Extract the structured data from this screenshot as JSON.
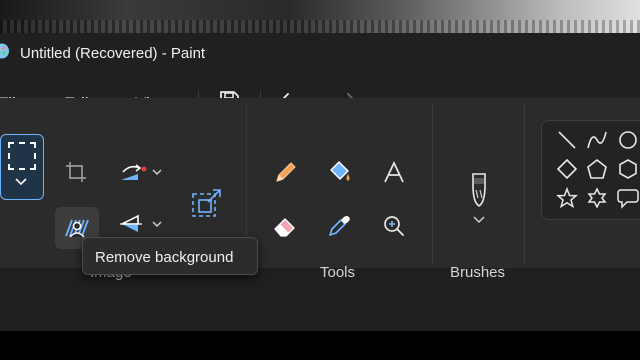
{
  "window": {
    "title": "Untitled (Recovered) - Paint"
  },
  "menu": {
    "file": "File",
    "edit": "Edit",
    "view": "View"
  },
  "toolbar": {
    "save_icon": "save-icon",
    "undo_icon": "undo-icon",
    "redo_icon": "redo-icon"
  },
  "ribbon": {
    "groups": {
      "image": "Image",
      "tools": "Tools",
      "brushes": "Brushes"
    },
    "image_tools": [
      "select-icon",
      "crop-icon",
      "rotate-icon",
      "remove-background-icon",
      "flip-icon",
      "resize-icon"
    ],
    "tools": [
      "pencil-icon",
      "fill-bucket-icon",
      "text-icon",
      "eraser-icon",
      "color-picker-icon",
      "magnifier-icon"
    ],
    "shapes": [
      "line-icon",
      "curve-icon",
      "oval-icon",
      "diamond-icon",
      "pentagon-icon",
      "hexagon-icon",
      "star-icon",
      "six-point-star-icon",
      "speech-bubble-icon"
    ]
  },
  "tooltip": {
    "text": "Remove background"
  },
  "colors": {
    "accent": "#6fb4ff",
    "window_bg": "#202020",
    "ribbon_bg": "#2b2b2b",
    "crayon": "#f2a05a",
    "rotate_dot": "#e0443e"
  }
}
